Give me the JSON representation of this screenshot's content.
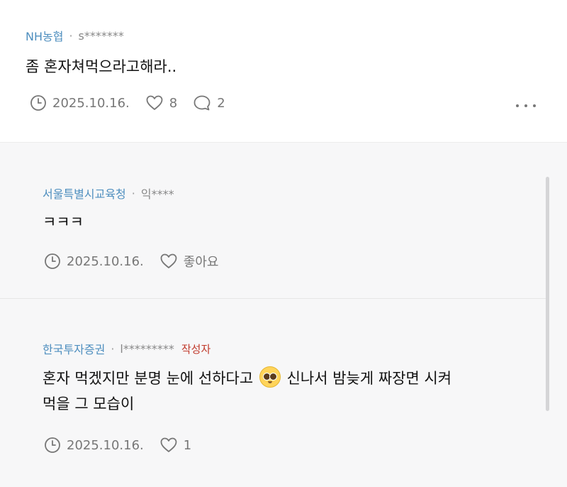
{
  "top_comment": {
    "company": "NH농협",
    "separator": "·",
    "user": "s*******",
    "text": "좀 혼자쳐먹으라고해라..",
    "date": "2025.10.16.",
    "likes": "8",
    "replies": "2"
  },
  "replies": [
    {
      "company": "서울특별시교육청",
      "separator": "·",
      "user": "익****",
      "text": "ㅋㅋㅋ",
      "date": "2025.10.16.",
      "like_label": "좋아요"
    },
    {
      "company": "한국투자증권",
      "separator": "·",
      "user": "l*********",
      "author_tag": "작성자",
      "text_part1": "혼자 먹겠지만 분명 눈에 선하다고",
      "text_part2": "신나서 밤늦게 짜장면 시켜",
      "text_line2": "먹을 그 모습이",
      "date": "2025.10.16.",
      "likes": "1"
    }
  ],
  "icons": {
    "clock": "clock-icon",
    "heart": "heart-icon",
    "comment": "comment-icon",
    "more": "more-dots-icon",
    "emoji": "pleading-face-emoji"
  },
  "colors": {
    "company": "#4f8fbf",
    "author_tag": "#c0392b",
    "reply_background": "#f7f7f8"
  }
}
